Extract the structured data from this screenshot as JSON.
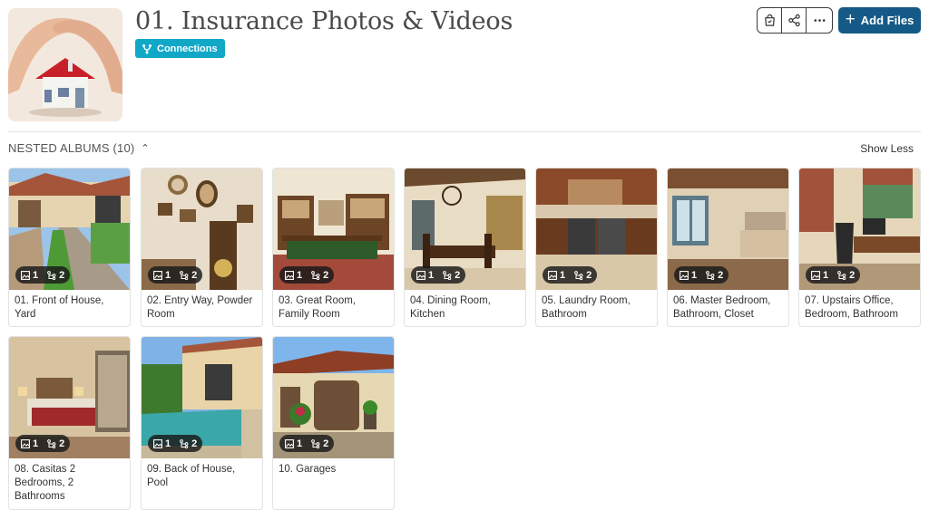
{
  "header": {
    "title": "01. Insurance Photos & Videos",
    "connections_label": "Connections",
    "add_files_label": "Add Files"
  },
  "toolbar": {
    "icons": [
      "shopping-bag-icon",
      "share-icon",
      "more-icon"
    ]
  },
  "section": {
    "title": "NESTED ALBUMS (10)",
    "show_less_label": "Show Less"
  },
  "albums": [
    {
      "label": "01. Front of House, Yard",
      "photos": "1",
      "albums": "2"
    },
    {
      "label": "02. Entry Way, Powder Room",
      "photos": "1",
      "albums": "2"
    },
    {
      "label": "03. Great Room, Family Room",
      "photos": "1",
      "albums": "2"
    },
    {
      "label": "04. Dining Room, Kitchen",
      "photos": "1",
      "albums": "2"
    },
    {
      "label": "05. Laundry Room, Bathroom",
      "photos": "1",
      "albums": "2"
    },
    {
      "label": "06. Master Bedroom, Bathroom, Closet",
      "photos": "1",
      "albums": "2"
    },
    {
      "label": "07. Upstairs Office, Bedroom, Bathroom",
      "photos": "1",
      "albums": "2"
    },
    {
      "label": "08. Casitas 2 Bedrooms, 2 Bathrooms",
      "photos": "1",
      "albums": "2"
    },
    {
      "label": "09. Back of House, Pool",
      "photos": "1",
      "albums": "2"
    },
    {
      "label": "10. Garages",
      "photos": "1",
      "albums": "2"
    }
  ],
  "colors": {
    "connections_badge": "#11a8c8",
    "add_files_button": "#155a86"
  }
}
